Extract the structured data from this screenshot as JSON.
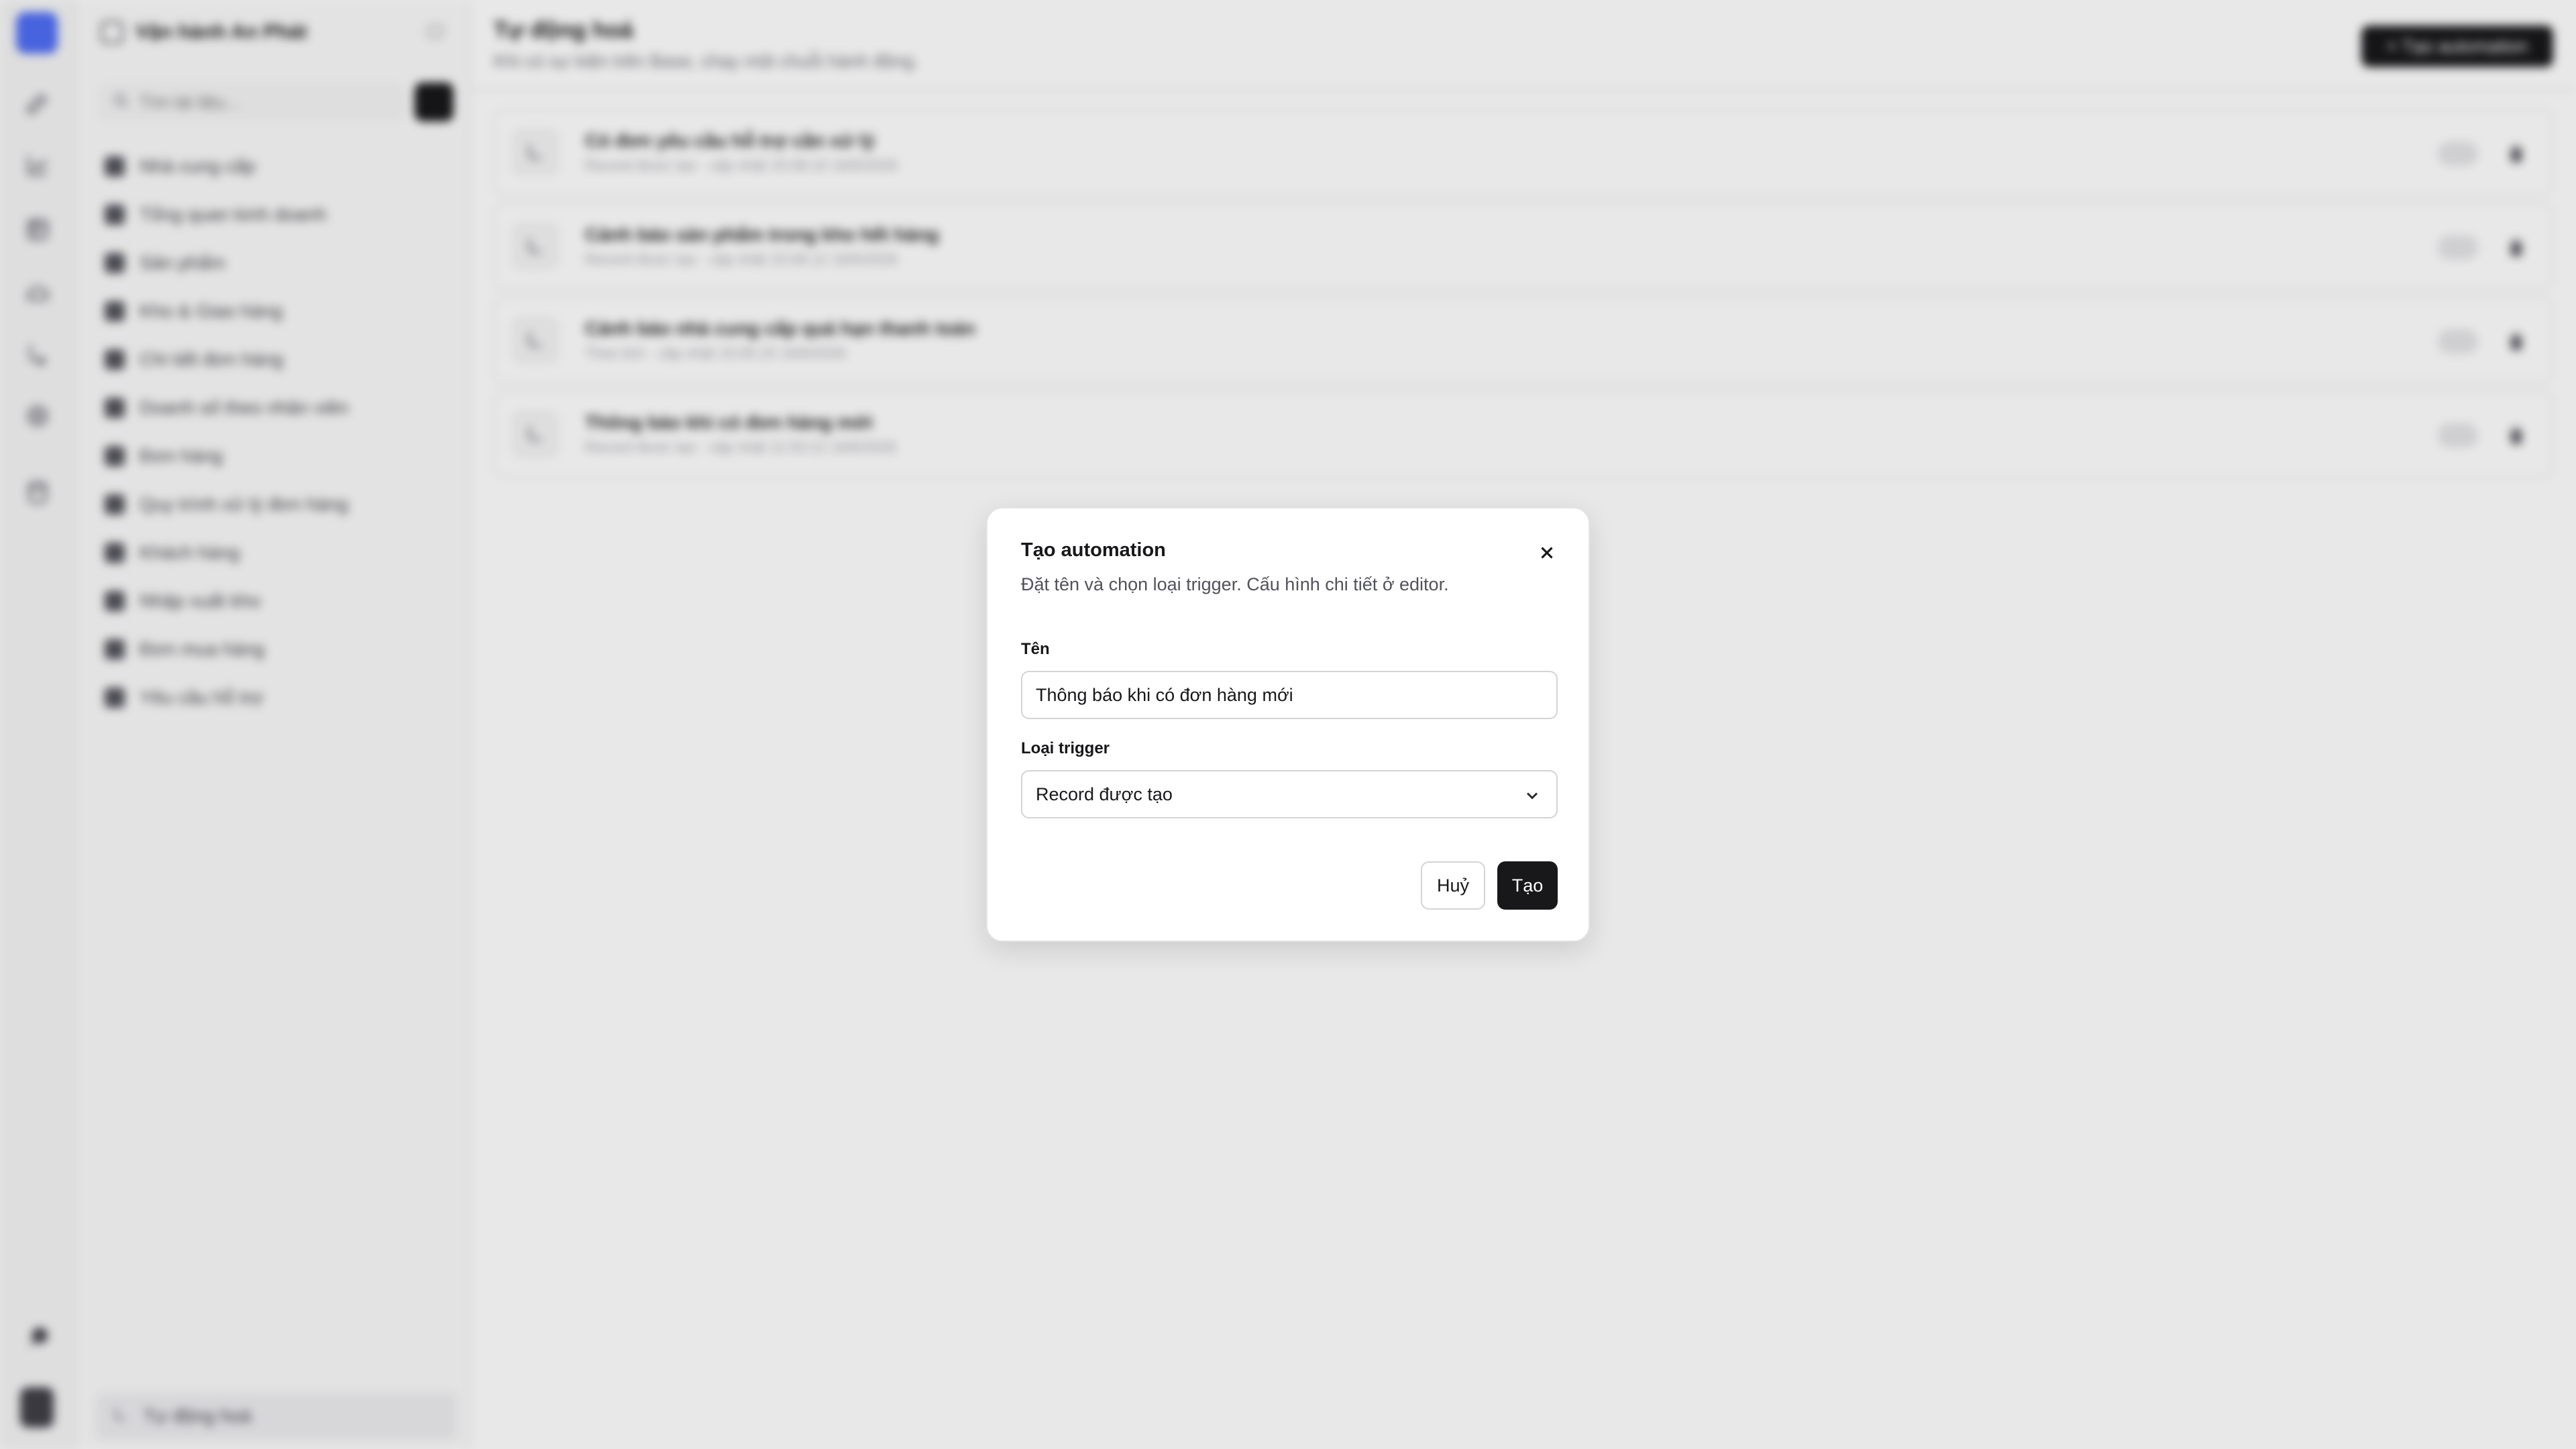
{
  "sidebar": {
    "workspace_name": "Vận hành An Phát",
    "search_placeholder": "Tìm tài liệu...",
    "items": [
      {
        "label": "Nhà cung cấp"
      },
      {
        "label": "Tổng quan kinh doanh"
      },
      {
        "label": "Sản phẩm"
      },
      {
        "label": "Kho & Giao hàng"
      },
      {
        "label": "Chi tiết đơn hàng"
      },
      {
        "label": "Doanh số theo nhân viên"
      },
      {
        "label": "Đơn hàng"
      },
      {
        "label": "Quy trình xử lý đơn hàng"
      },
      {
        "label": "Khách hàng"
      },
      {
        "label": "Nhập xuất kho"
      },
      {
        "label": "Đơn mua hàng"
      },
      {
        "label": "Yêu cầu hỗ trợ"
      }
    ],
    "footer_label": "Tự động hoá"
  },
  "main": {
    "title": "Tự động hoá",
    "subtitle": "Khi có sự kiện trên Base, chạy một chuỗi hành động.",
    "create_button_label": "+ Tạo automation",
    "automations": [
      {
        "title": "Có đơn yêu cầu hỗ trợ cần xử lý",
        "meta": "Record được tạo · cập nhật 15:08:10 16/6/2026"
      },
      {
        "title": "Cảnh báo sản phẩm trong kho hết hàng",
        "meta": "Record được tạo · cập nhật 15:06:12 16/6/2026"
      },
      {
        "title": "Cảnh báo nhà cung cấp quá hạn thanh toán",
        "meta": "Theo lịch · cập nhật 15:05:15 16/6/2026"
      },
      {
        "title": "Thông báo khi có đơn hàng mới",
        "meta": "Record được tạo · cập nhật 11:53:12 16/6/2026"
      }
    ]
  },
  "modal": {
    "title": "Tạo automation",
    "description": "Đặt tên và chọn loại trigger. Cấu hình chi tiết ở editor.",
    "name_label": "Tên",
    "name_value": "Thông báo khi có đơn hàng mới",
    "trigger_label": "Loại trigger",
    "trigger_value": "Record được tạo",
    "cancel_label": "Huỷ",
    "create_label": "Tạo"
  },
  "colors": {
    "accent": "#4f6df5",
    "primary_button": "#18181b",
    "overlay": "rgba(0,0,0,0.09)"
  }
}
